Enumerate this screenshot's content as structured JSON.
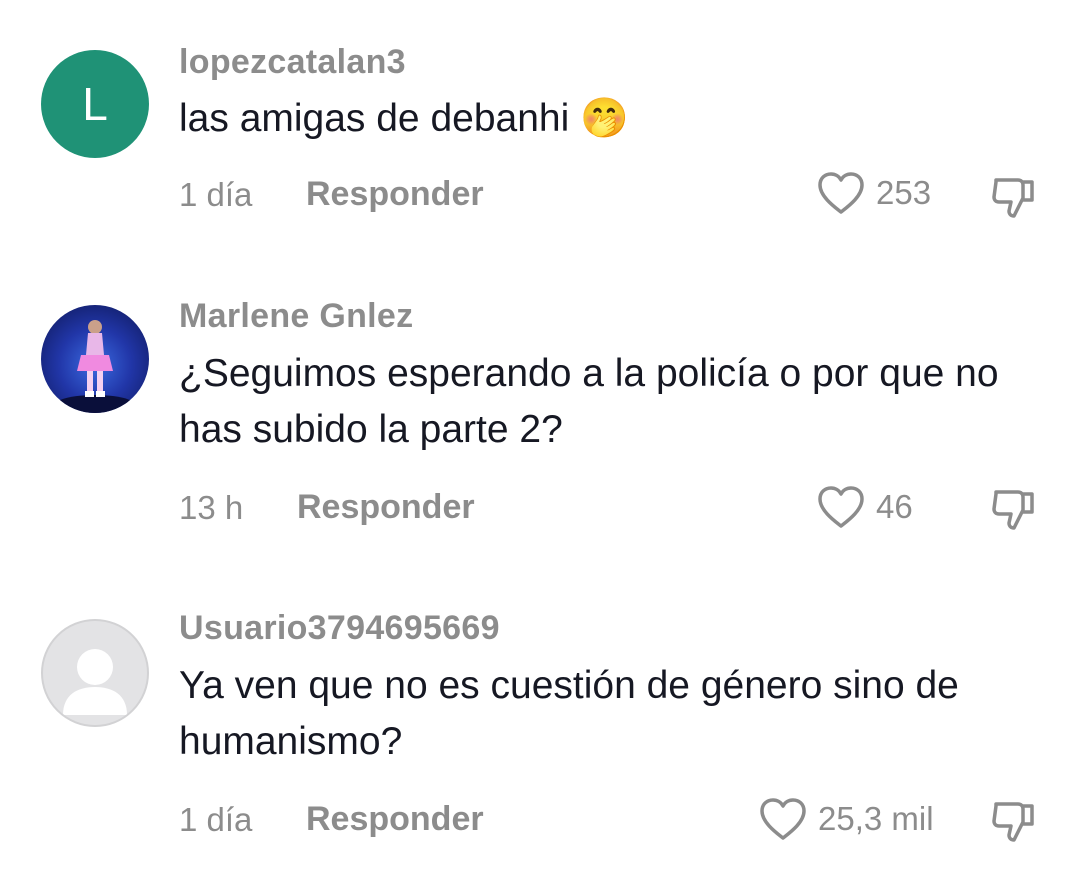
{
  "comments": [
    {
      "username": "lopezcatalan3",
      "avatar_letter": "L",
      "text": "las amigas de debanhi 🤭",
      "time": "1 día",
      "reply_label": "Responder",
      "likes": "253"
    },
    {
      "username": "Marlene Gnlez",
      "text": "¿Seguimos esperando a la policía o por que no has subido la parte 2?",
      "time": "13 h",
      "reply_label": "Responder",
      "likes": "46"
    },
    {
      "username": "Usuario3794695669",
      "text": "Ya ven que no es cuestión de género sino de humanismo?",
      "time": "1 día",
      "reply_label": "Responder",
      "likes": "25,3 mil"
    }
  ],
  "colors": {
    "avatar_letter_bg": "#1f9276",
    "secondary_text": "#8c8c8c",
    "primary_text": "#161823"
  },
  "icons": [
    "heart-outline-icon",
    "thumbs-down-icon",
    "default-user-icon"
  ]
}
